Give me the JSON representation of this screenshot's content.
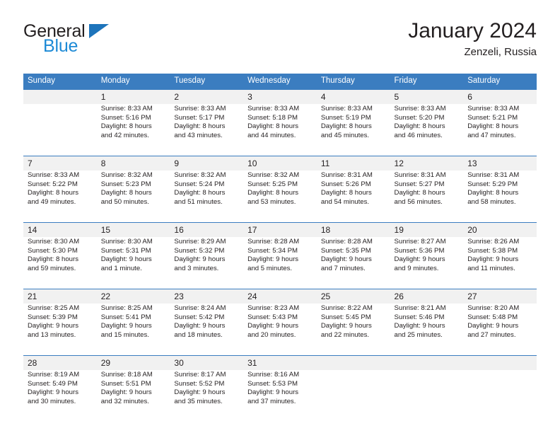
{
  "brand": {
    "name_line1": "General",
    "name_line2": "Blue",
    "color_dark": "#231f20",
    "color_blue": "#1d8ad6",
    "triangle_color": "#1d74bb"
  },
  "header": {
    "title": "January 2024",
    "subtitle": "Zenzeli, Russia"
  },
  "theme": {
    "header_row_bg": "#3b7dc0",
    "date_row_bg": "#f1f1f1",
    "cell_bg": "#ffffff",
    "text": "#231f20"
  },
  "weekdays": [
    "Sunday",
    "Monday",
    "Tuesday",
    "Wednesday",
    "Thursday",
    "Friday",
    "Saturday"
  ],
  "weeks": [
    [
      {
        "day": "",
        "sunrise": "",
        "sunset": "",
        "daylight_line1": "",
        "daylight_line2": ""
      },
      {
        "day": "1",
        "sunrise": "Sunrise: 8:33 AM",
        "sunset": "Sunset: 5:16 PM",
        "daylight_line1": "Daylight: 8 hours",
        "daylight_line2": "and 42 minutes."
      },
      {
        "day": "2",
        "sunrise": "Sunrise: 8:33 AM",
        "sunset": "Sunset: 5:17 PM",
        "daylight_line1": "Daylight: 8 hours",
        "daylight_line2": "and 43 minutes."
      },
      {
        "day": "3",
        "sunrise": "Sunrise: 8:33 AM",
        "sunset": "Sunset: 5:18 PM",
        "daylight_line1": "Daylight: 8 hours",
        "daylight_line2": "and 44 minutes."
      },
      {
        "day": "4",
        "sunrise": "Sunrise: 8:33 AM",
        "sunset": "Sunset: 5:19 PM",
        "daylight_line1": "Daylight: 8 hours",
        "daylight_line2": "and 45 minutes."
      },
      {
        "day": "5",
        "sunrise": "Sunrise: 8:33 AM",
        "sunset": "Sunset: 5:20 PM",
        "daylight_line1": "Daylight: 8 hours",
        "daylight_line2": "and 46 minutes."
      },
      {
        "day": "6",
        "sunrise": "Sunrise: 8:33 AM",
        "sunset": "Sunset: 5:21 PM",
        "daylight_line1": "Daylight: 8 hours",
        "daylight_line2": "and 47 minutes."
      }
    ],
    [
      {
        "day": "7",
        "sunrise": "Sunrise: 8:33 AM",
        "sunset": "Sunset: 5:22 PM",
        "daylight_line1": "Daylight: 8 hours",
        "daylight_line2": "and 49 minutes."
      },
      {
        "day": "8",
        "sunrise": "Sunrise: 8:32 AM",
        "sunset": "Sunset: 5:23 PM",
        "daylight_line1": "Daylight: 8 hours",
        "daylight_line2": "and 50 minutes."
      },
      {
        "day": "9",
        "sunrise": "Sunrise: 8:32 AM",
        "sunset": "Sunset: 5:24 PM",
        "daylight_line1": "Daylight: 8 hours",
        "daylight_line2": "and 51 minutes."
      },
      {
        "day": "10",
        "sunrise": "Sunrise: 8:32 AM",
        "sunset": "Sunset: 5:25 PM",
        "daylight_line1": "Daylight: 8 hours",
        "daylight_line2": "and 53 minutes."
      },
      {
        "day": "11",
        "sunrise": "Sunrise: 8:31 AM",
        "sunset": "Sunset: 5:26 PM",
        "daylight_line1": "Daylight: 8 hours",
        "daylight_line2": "and 54 minutes."
      },
      {
        "day": "12",
        "sunrise": "Sunrise: 8:31 AM",
        "sunset": "Sunset: 5:27 PM",
        "daylight_line1": "Daylight: 8 hours",
        "daylight_line2": "and 56 minutes."
      },
      {
        "day": "13",
        "sunrise": "Sunrise: 8:31 AM",
        "sunset": "Sunset: 5:29 PM",
        "daylight_line1": "Daylight: 8 hours",
        "daylight_line2": "and 58 minutes."
      }
    ],
    [
      {
        "day": "14",
        "sunrise": "Sunrise: 8:30 AM",
        "sunset": "Sunset: 5:30 PM",
        "daylight_line1": "Daylight: 8 hours",
        "daylight_line2": "and 59 minutes."
      },
      {
        "day": "15",
        "sunrise": "Sunrise: 8:30 AM",
        "sunset": "Sunset: 5:31 PM",
        "daylight_line1": "Daylight: 9 hours",
        "daylight_line2": "and 1 minute."
      },
      {
        "day": "16",
        "sunrise": "Sunrise: 8:29 AM",
        "sunset": "Sunset: 5:32 PM",
        "daylight_line1": "Daylight: 9 hours",
        "daylight_line2": "and 3 minutes."
      },
      {
        "day": "17",
        "sunrise": "Sunrise: 8:28 AM",
        "sunset": "Sunset: 5:34 PM",
        "daylight_line1": "Daylight: 9 hours",
        "daylight_line2": "and 5 minutes."
      },
      {
        "day": "18",
        "sunrise": "Sunrise: 8:28 AM",
        "sunset": "Sunset: 5:35 PM",
        "daylight_line1": "Daylight: 9 hours",
        "daylight_line2": "and 7 minutes."
      },
      {
        "day": "19",
        "sunrise": "Sunrise: 8:27 AM",
        "sunset": "Sunset: 5:36 PM",
        "daylight_line1": "Daylight: 9 hours",
        "daylight_line2": "and 9 minutes."
      },
      {
        "day": "20",
        "sunrise": "Sunrise: 8:26 AM",
        "sunset": "Sunset: 5:38 PM",
        "daylight_line1": "Daylight: 9 hours",
        "daylight_line2": "and 11 minutes."
      }
    ],
    [
      {
        "day": "21",
        "sunrise": "Sunrise: 8:25 AM",
        "sunset": "Sunset: 5:39 PM",
        "daylight_line1": "Daylight: 9 hours",
        "daylight_line2": "and 13 minutes."
      },
      {
        "day": "22",
        "sunrise": "Sunrise: 8:25 AM",
        "sunset": "Sunset: 5:41 PM",
        "daylight_line1": "Daylight: 9 hours",
        "daylight_line2": "and 15 minutes."
      },
      {
        "day": "23",
        "sunrise": "Sunrise: 8:24 AM",
        "sunset": "Sunset: 5:42 PM",
        "daylight_line1": "Daylight: 9 hours",
        "daylight_line2": "and 18 minutes."
      },
      {
        "day": "24",
        "sunrise": "Sunrise: 8:23 AM",
        "sunset": "Sunset: 5:43 PM",
        "daylight_line1": "Daylight: 9 hours",
        "daylight_line2": "and 20 minutes."
      },
      {
        "day": "25",
        "sunrise": "Sunrise: 8:22 AM",
        "sunset": "Sunset: 5:45 PM",
        "daylight_line1": "Daylight: 9 hours",
        "daylight_line2": "and 22 minutes."
      },
      {
        "day": "26",
        "sunrise": "Sunrise: 8:21 AM",
        "sunset": "Sunset: 5:46 PM",
        "daylight_line1": "Daylight: 9 hours",
        "daylight_line2": "and 25 minutes."
      },
      {
        "day": "27",
        "sunrise": "Sunrise: 8:20 AM",
        "sunset": "Sunset: 5:48 PM",
        "daylight_line1": "Daylight: 9 hours",
        "daylight_line2": "and 27 minutes."
      }
    ],
    [
      {
        "day": "28",
        "sunrise": "Sunrise: 8:19 AM",
        "sunset": "Sunset: 5:49 PM",
        "daylight_line1": "Daylight: 9 hours",
        "daylight_line2": "and 30 minutes."
      },
      {
        "day": "29",
        "sunrise": "Sunrise: 8:18 AM",
        "sunset": "Sunset: 5:51 PM",
        "daylight_line1": "Daylight: 9 hours",
        "daylight_line2": "and 32 minutes."
      },
      {
        "day": "30",
        "sunrise": "Sunrise: 8:17 AM",
        "sunset": "Sunset: 5:52 PM",
        "daylight_line1": "Daylight: 9 hours",
        "daylight_line2": "and 35 minutes."
      },
      {
        "day": "31",
        "sunrise": "Sunrise: 8:16 AM",
        "sunset": "Sunset: 5:53 PM",
        "daylight_line1": "Daylight: 9 hours",
        "daylight_line2": "and 37 minutes."
      },
      {
        "day": "",
        "sunrise": "",
        "sunset": "",
        "daylight_line1": "",
        "daylight_line2": ""
      },
      {
        "day": "",
        "sunrise": "",
        "sunset": "",
        "daylight_line1": "",
        "daylight_line2": ""
      },
      {
        "day": "",
        "sunrise": "",
        "sunset": "",
        "daylight_line1": "",
        "daylight_line2": ""
      }
    ]
  ]
}
